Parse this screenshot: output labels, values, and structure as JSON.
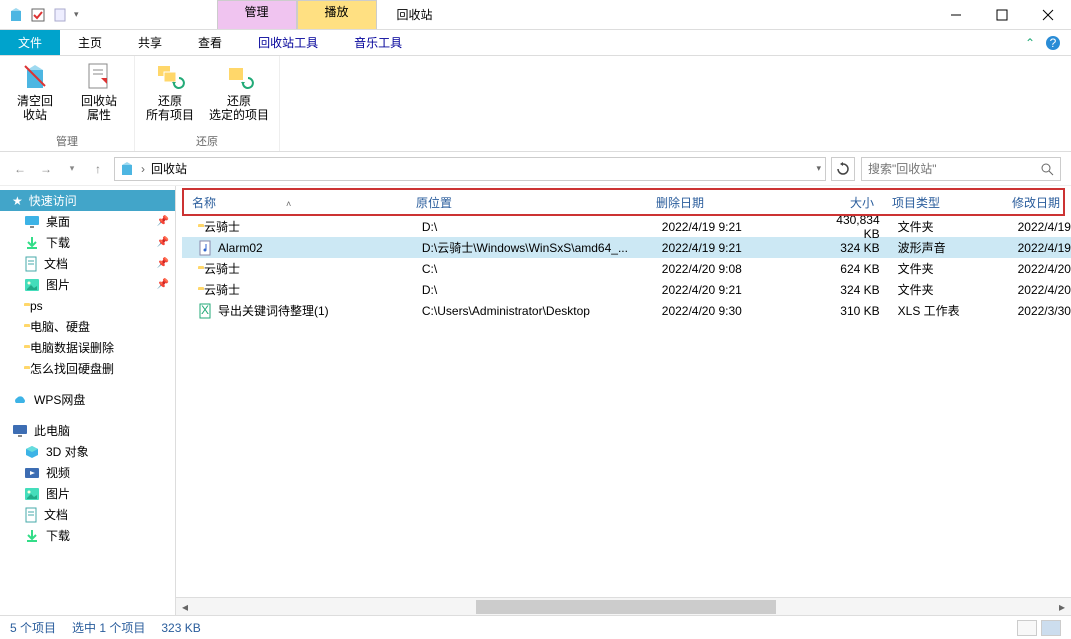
{
  "title_tabs": {
    "manage": "管理",
    "play": "播放"
  },
  "window_title": "回收站",
  "ribbon": {
    "tabs": {
      "file": "文件",
      "home": "主页",
      "share": "共享",
      "view": "查看",
      "recycle_tools": "回收站工具",
      "music_tools": "音乐工具"
    },
    "groups": {
      "manage": {
        "label": "管理",
        "empty": "清空回\n收站",
        "props": "回收站\n属性"
      },
      "restore": {
        "label": "还原",
        "restore_all": "还原\n所有项目",
        "restore_sel": "还原\n选定的项目"
      }
    }
  },
  "addressbar": {
    "crumb": "回收站"
  },
  "search": {
    "placeholder": "搜索\"回收站\""
  },
  "nav": {
    "quick_access": "快速访问",
    "items": [
      {
        "icon": "desktop",
        "label": "桌面",
        "pinned": true
      },
      {
        "icon": "download",
        "label": "下载",
        "pinned": true
      },
      {
        "icon": "doc",
        "label": "文档",
        "pinned": true
      },
      {
        "icon": "picture",
        "label": "图片",
        "pinned": true
      },
      {
        "icon": "folder",
        "label": "ps",
        "pinned": false
      },
      {
        "icon": "folder",
        "label": "电脑、硬盘",
        "pinned": false
      },
      {
        "icon": "folder",
        "label": "电脑数据误删除",
        "pinned": false
      },
      {
        "icon": "folder",
        "label": "怎么找回硬盘删",
        "pinned": false
      }
    ],
    "wps": "WPS网盘",
    "this_pc": "此电脑",
    "pc_items": [
      {
        "icon": "3d",
        "label": "3D 对象"
      },
      {
        "icon": "video",
        "label": "视频"
      },
      {
        "icon": "picture",
        "label": "图片"
      },
      {
        "icon": "doc",
        "label": "文档"
      },
      {
        "icon": "download",
        "label": "下载"
      }
    ]
  },
  "columns": {
    "name": "名称",
    "location": "原位置",
    "deleted": "删除日期",
    "size": "大小",
    "type": "项目类型",
    "modified": "修改日期"
  },
  "rows": [
    {
      "icon": "folder",
      "name": "云骑士",
      "location": "D:\\",
      "deleted": "2022/4/19 9:21",
      "size": "430,834 KB",
      "type": "文件夹",
      "modified": "2022/4/19",
      "selected": false
    },
    {
      "icon": "music",
      "name": "Alarm02",
      "location": "D:\\云骑士\\Windows\\WinSxS\\amd64_...",
      "deleted": "2022/4/19 9:21",
      "size": "324 KB",
      "type": "波形声音",
      "modified": "2022/4/19",
      "selected": true
    },
    {
      "icon": "folder",
      "name": "云骑士",
      "location": "C:\\",
      "deleted": "2022/4/20 9:08",
      "size": "624 KB",
      "type": "文件夹",
      "modified": "2022/4/20",
      "selected": false
    },
    {
      "icon": "folder",
      "name": "云骑士",
      "location": "D:\\",
      "deleted": "2022/4/20 9:21",
      "size": "324 KB",
      "type": "文件夹",
      "modified": "2022/4/20",
      "selected": false
    },
    {
      "icon": "xls",
      "name": "导出关键词待整理(1)",
      "location": "C:\\Users\\Administrator\\Desktop",
      "deleted": "2022/4/20 9:30",
      "size": "310 KB",
      "type": "XLS 工作表",
      "modified": "2022/3/30",
      "selected": false
    }
  ],
  "status": {
    "count": "5 个项目",
    "selected": "选中 1 个项目",
    "size": "323 KB"
  }
}
